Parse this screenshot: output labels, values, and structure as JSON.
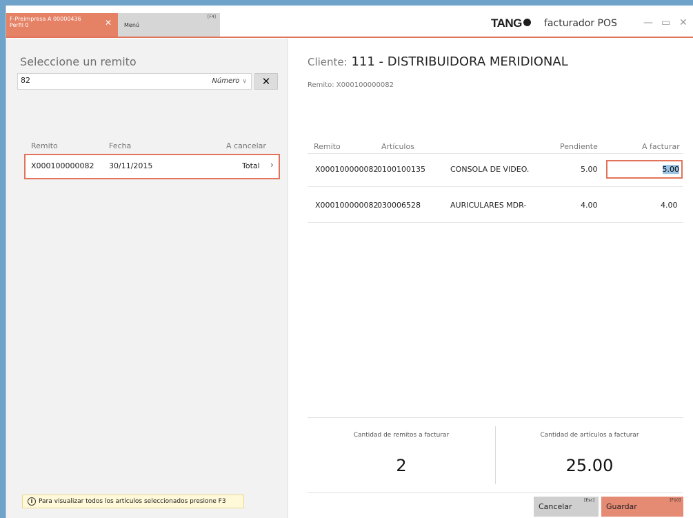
{
  "tabs": {
    "active": {
      "line1": "F-Preimpresa A 00000436",
      "line2": "Perfil 0"
    },
    "menu": {
      "label": "Menú",
      "key": "[F4]"
    }
  },
  "brand": {
    "logo": "TANG",
    "product": "facturador POS"
  },
  "window_controls": {
    "minimize": "—",
    "maximize": "▭",
    "close": "✕"
  },
  "left": {
    "title": "Seleccione un remito",
    "search": {
      "value": "82",
      "mode": "Número"
    },
    "headers": {
      "remito": "Remito",
      "fecha": "Fecha",
      "cancelar": "A cancelar"
    },
    "rows": [
      {
        "remito": "X000100000082",
        "fecha": "30/11/2015",
        "cancelar": "Total"
      }
    ],
    "hint": "Para visualizar todos los artículos seleccionados presione F3"
  },
  "right": {
    "cliente_label": "Cliente:",
    "cliente_code": "111",
    "cliente_sep": "-",
    "cliente_name": "DISTRIBUIDORA MERIDIONAL",
    "remito_label": "Remito:",
    "remito_value": "X000100000082",
    "headers": {
      "remito": "Remito",
      "articulos": "Artículos",
      "pendiente": "Pendiente",
      "facturar": "A facturar"
    },
    "rows": [
      {
        "remito": "X000100000082",
        "codigo": "0100100135",
        "desc": "CONSOLA DE VIDEO.",
        "pendiente": "5.00",
        "facturar": "5.00"
      },
      {
        "remito": "X000100000082",
        "codigo": "030006528",
        "desc": "AURICULARES MDR-",
        "pendiente": "4.00",
        "facturar": "4.00"
      }
    ],
    "summary": {
      "remitos_label": "Cantidad de remitos a facturar",
      "remitos_value": "2",
      "articulos_label": "Cantidad de artículos a facturar",
      "articulos_value": "25.00"
    },
    "buttons": {
      "cancelar": {
        "label": "Cancelar",
        "key": "[Esc]"
      },
      "guardar": {
        "label": "Guardar",
        "key": "[F10]"
      }
    }
  },
  "colors": {
    "accent": "#e2725a",
    "tab_active": "#e58165",
    "guardar": "#e58a73",
    "cancelar": "#cfcfcf",
    "desktop": "#6fa3c9"
  }
}
